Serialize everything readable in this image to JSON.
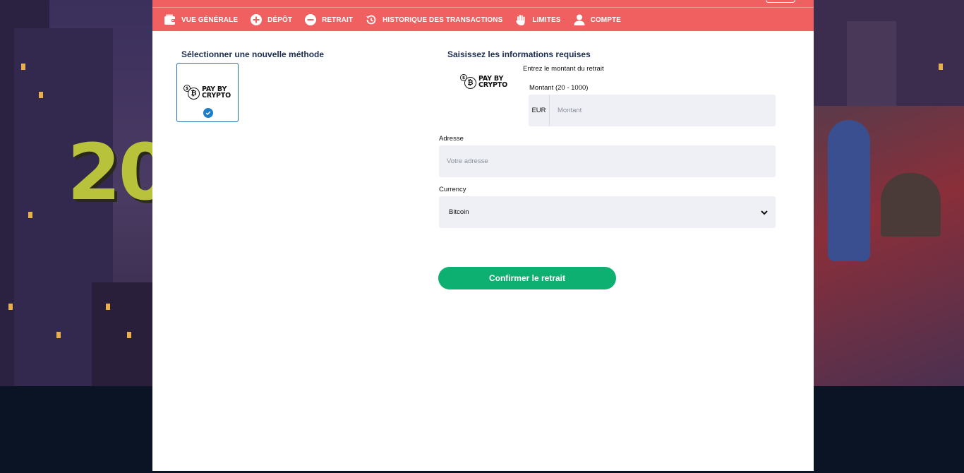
{
  "nav": {
    "items": [
      {
        "label": "VUE GÉNÉRALE",
        "icon": "wallet-icon"
      },
      {
        "label": "DÉPÔT",
        "icon": "plus-circle-icon"
      },
      {
        "label": "RETRAIT",
        "icon": "minus-circle-icon"
      },
      {
        "label": "HISTORIQUE DES TRANSACTIONS",
        "icon": "history-icon"
      },
      {
        "label": "LIMITES",
        "icon": "hand-icon"
      },
      {
        "label": "COMPTE",
        "icon": "user-icon"
      }
    ]
  },
  "left": {
    "title": "Sélectionner une nouvelle méthode",
    "method": {
      "logo_text": "PAY BY CRYPTO",
      "selected": true
    }
  },
  "right": {
    "title": "Saisissez les informations requises",
    "logo_text": "PAY BY CRYPTO",
    "amount_prompt": "Entrez le montant du retrait",
    "amount_label": "Montant (20 - 1000)",
    "currency_prefix": "EUR",
    "amount_placeholder": "Montant",
    "address_label": "Adresse",
    "address_placeholder": "Votre adresse",
    "currency_label": "Currency",
    "currency_value": "Bitcoin",
    "confirm_label": "Confirmer le retrait"
  },
  "background": {
    "promo_text": "20"
  },
  "colors": {
    "nav_bg": "#f06060",
    "title_text": "#1c2d52",
    "confirm_bg": "#0db070",
    "selected_border": "#1e6fb5",
    "input_bg": "#eff0f5"
  }
}
